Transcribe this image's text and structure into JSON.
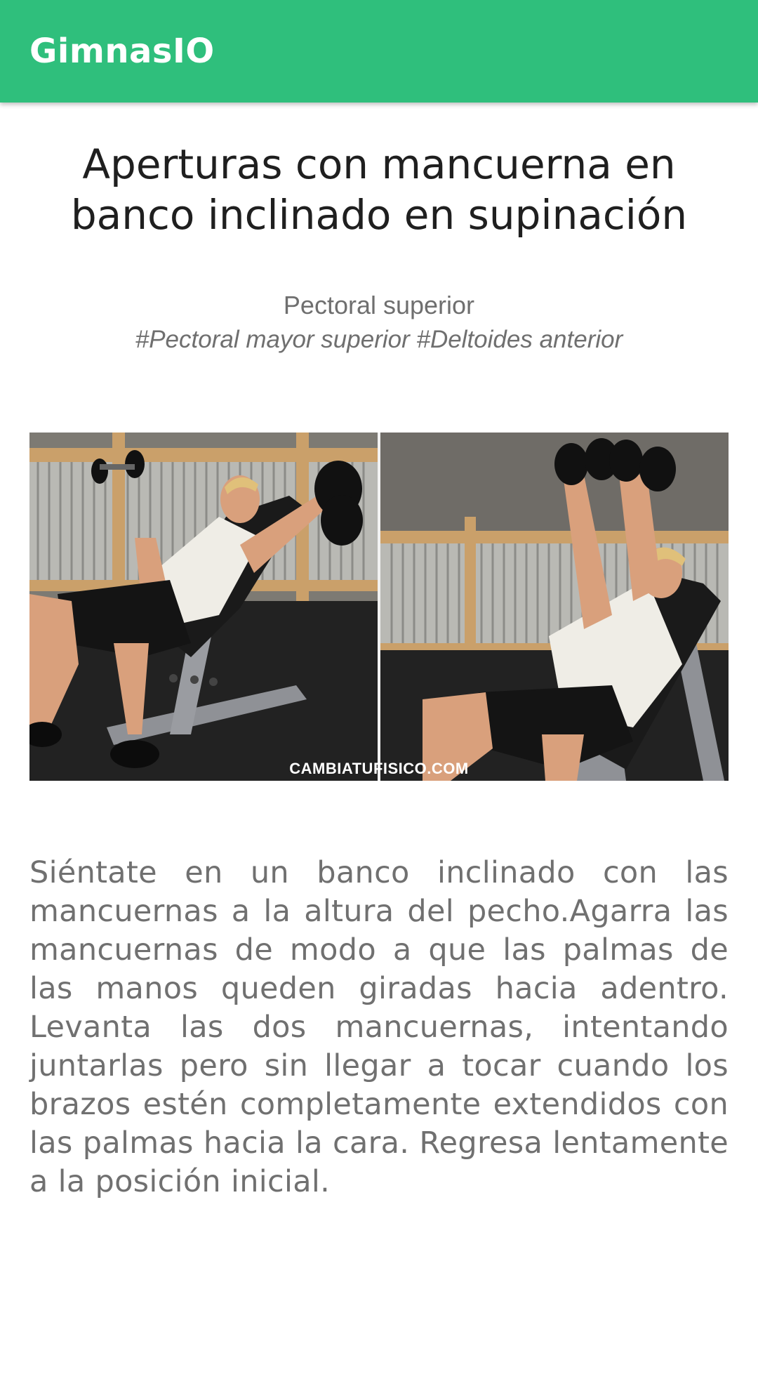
{
  "app_bar": {
    "title": "GimnasIO"
  },
  "exercise": {
    "title": "Aperturas con mancuerna en banco inclinado en supinación",
    "muscle_group": "Pectoral superior",
    "muscle_tags": "#Pectoral mayor superior #Deltoides anterior",
    "image": {
      "watermark": "CAMBIATUFISICO.COM"
    },
    "description": "Siéntate en un banco inclinado con las mancuernas a la altura del pecho.Agarra las mancuernas de modo a que las palmas de las manos queden giradas hacia adentro. Levanta las dos mancuernas, intentando juntarlas pero sin llegar a tocar cuando los brazos estén completamente extendidos con las palmas hacia la cara. Regresa lentamente a la posición inicial."
  },
  "colors": {
    "app_bar": "#2fbf7c",
    "title_text": "#1f1f1f",
    "secondary_text": "#707070"
  }
}
